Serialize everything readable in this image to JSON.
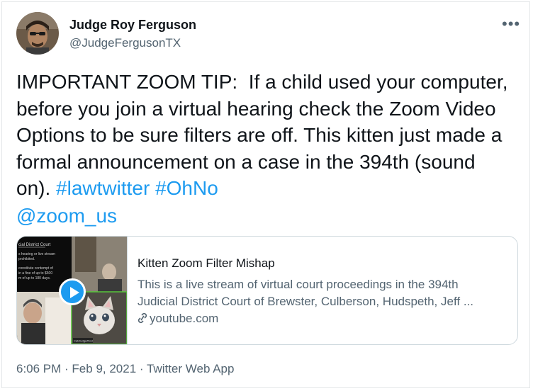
{
  "author": {
    "name": "Judge Roy Ferguson",
    "handle": "@JudgeFergusonTX"
  },
  "more_label": "•••",
  "tweet": {
    "line1": "IMPORTANT ZOOM TIP:  If a child used your computer,",
    "line2": "before you join a virtual hearing check the Zoom Video",
    "line3": "Options to be sure filters are off. This kitten just made a",
    "line4": "formal announcement on a case in the 394th (sound",
    "line5_prefix": "on). ",
    "hashtag1": "#lawtwitter",
    "hashtag2": "#OhNo",
    "mention": "@zoom_us"
  },
  "link_preview": {
    "title": "Kitten Zoom Filter Mishap",
    "description_line1": "This is a live stream of virtual court proceedings in the 394th",
    "description_line2": "Judicial District Court of Brewster, Culberson, Hudspeth, Jeff ...",
    "domain": "youtube.com",
    "thumbnail_text": {
      "court": "cial District Court",
      "notice1": "s hearing or live stream",
      "notice2": "prohibited.",
      "notice3": "constitute contempt of",
      "notice4": "in a fine of up to $500",
      "notice5": "m of up to 180 days.",
      "tile_label": "Cat/Judge/Rod"
    }
  },
  "footer": {
    "time": "6:06 PM",
    "date": "Feb 9, 2021",
    "source": "Twitter Web App",
    "separator": " · "
  },
  "colors": {
    "link": "#1d9bf0",
    "secondary_text": "#536471",
    "primary_text": "#0f1419",
    "border": "#cfd9de"
  }
}
